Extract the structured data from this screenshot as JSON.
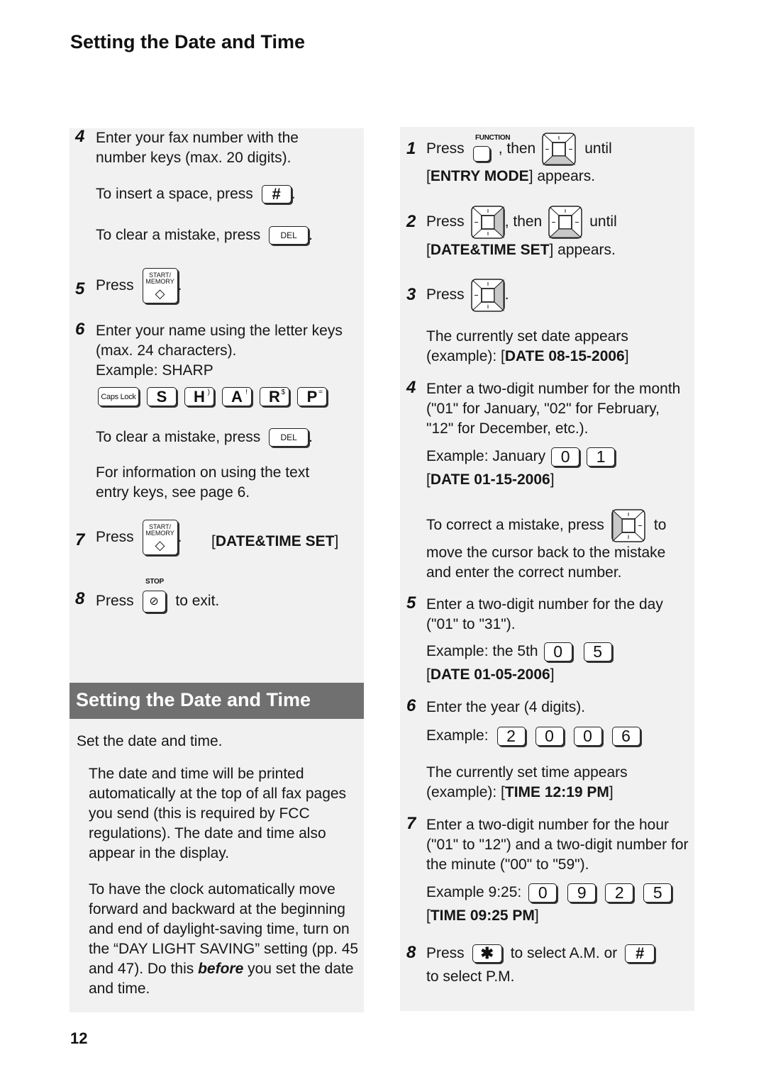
{
  "page": {
    "title": "Setting the Date and Time",
    "page_number": "12"
  },
  "left": {
    "step4": {
      "num": "4",
      "text": "Enter your fax number with the number keys (max. 20 digits).",
      "space_text": "To insert a space, press",
      "space_key": "#",
      "clear_text": "To clear a mistake, press",
      "del_key": "DEL"
    },
    "step5": {
      "num": "5",
      "text": "Press",
      "key_line1": "START/",
      "key_line2": "MEMORY",
      "key_symbol": "◇"
    },
    "step6": {
      "num": "6",
      "text": "Enter your name using the letter keys (max. 24 characters).",
      "example": "Example: SHARP",
      "keys": [
        {
          "label": "Caps Lock",
          "alt": ""
        },
        {
          "label": "S",
          "alt": ""
        },
        {
          "label": "H",
          "alt": ")"
        },
        {
          "label": "A",
          "alt": "!"
        },
        {
          "label": "R",
          "alt": "$"
        },
        {
          "label": "P",
          "alt": "="
        }
      ],
      "clear_text": "To clear a mistake, press",
      "del_key": "DEL",
      "info_text": "For information on using the text entry keys, see page 6."
    },
    "step7": {
      "num": "7",
      "text": "Press",
      "key_line1": "START/",
      "key_line2": "MEMORY",
      "display_pre": "[",
      "display": "DATE&TIME SET",
      "display_post": "]"
    },
    "step8": {
      "num": "8",
      "text": "Press",
      "key_label": "STOP",
      "after": "to exit."
    },
    "section": {
      "heading": "Setting the Date and Time",
      "intro": "Set the date and time.",
      "para1": "The date and time will be printed automatically at the top of all fax pages you send (this is required by FCC regulations). The date and time also appear in the display.",
      "para2_before": "To have the clock automatically move forward and backward at the beginning and end of daylight-saving time, turn on the “DAY LIGHT SAVING” setting (pp. 45 and 47). Do this ",
      "para2_emph": "before",
      "para2_after": " you set the date and time."
    }
  },
  "right": {
    "step1": {
      "num": "1",
      "press": "Press",
      "func_label": "FUNCTION",
      "then": ", then",
      "until": "until",
      "display": "ENTRY MODE",
      "appears": "] appears."
    },
    "step2": {
      "num": "2",
      "press": "Press",
      "then": ", then",
      "until": "until",
      "display": "DATE&TIME SET",
      "appears": "] appears."
    },
    "step3": {
      "num": "3",
      "press": "Press",
      "date_text": "The currently set date appears",
      "date_example_pre": "(example): [",
      "date_example": "DATE 08-15-2006",
      "date_example_post": "]"
    },
    "step4": {
      "num": "4",
      "text": "Enter a two-digit number for the month (\"01\" for January, \"02\" for February, \"12\" for December, etc.).",
      "example": "Example: January",
      "keys": [
        "0",
        "1"
      ],
      "display": "DATE 01-15-2006",
      "correct_pre": "To correct a mistake, press",
      "correct_post": "to",
      "correct_rest": "move the cursor back to the mistake and enter the correct number."
    },
    "step5": {
      "num": "5",
      "text": "Enter a two-digit number for the day (\"01\" to \"31\").",
      "example": "Example:  the 5th",
      "keys": [
        "0",
        "5"
      ],
      "display": "DATE 01-05-2006"
    },
    "step6": {
      "num": "6",
      "text": "Enter the year (4 digits).",
      "example": "Example:",
      "keys": [
        "2",
        "0",
        "0",
        "6"
      ],
      "time_text": "The currently set time appears",
      "time_example_pre": "(example): [",
      "time_example": "TIME 12:19 PM",
      "time_example_post": "]"
    },
    "step7": {
      "num": "7",
      "text": "Enter a two-digit number for the hour (\"01\" to \"12\") and a two-digit number for the minute (\"00\" to \"59\").",
      "example": "Example 9:25:",
      "keys": [
        "0",
        "9",
        "2",
        "5"
      ],
      "display": "TIME 09:25 PM"
    },
    "step8": {
      "num": "8",
      "press": "Press",
      "am_key": "✱",
      "am_text": "to select A.M. or",
      "pm_key": "#",
      "pm_text": "to select P.M."
    }
  },
  "colors": {
    "panel_bg": "#f1f1f1",
    "section_bar": "#707070",
    "pad_highlight": "#c8c8c8"
  }
}
